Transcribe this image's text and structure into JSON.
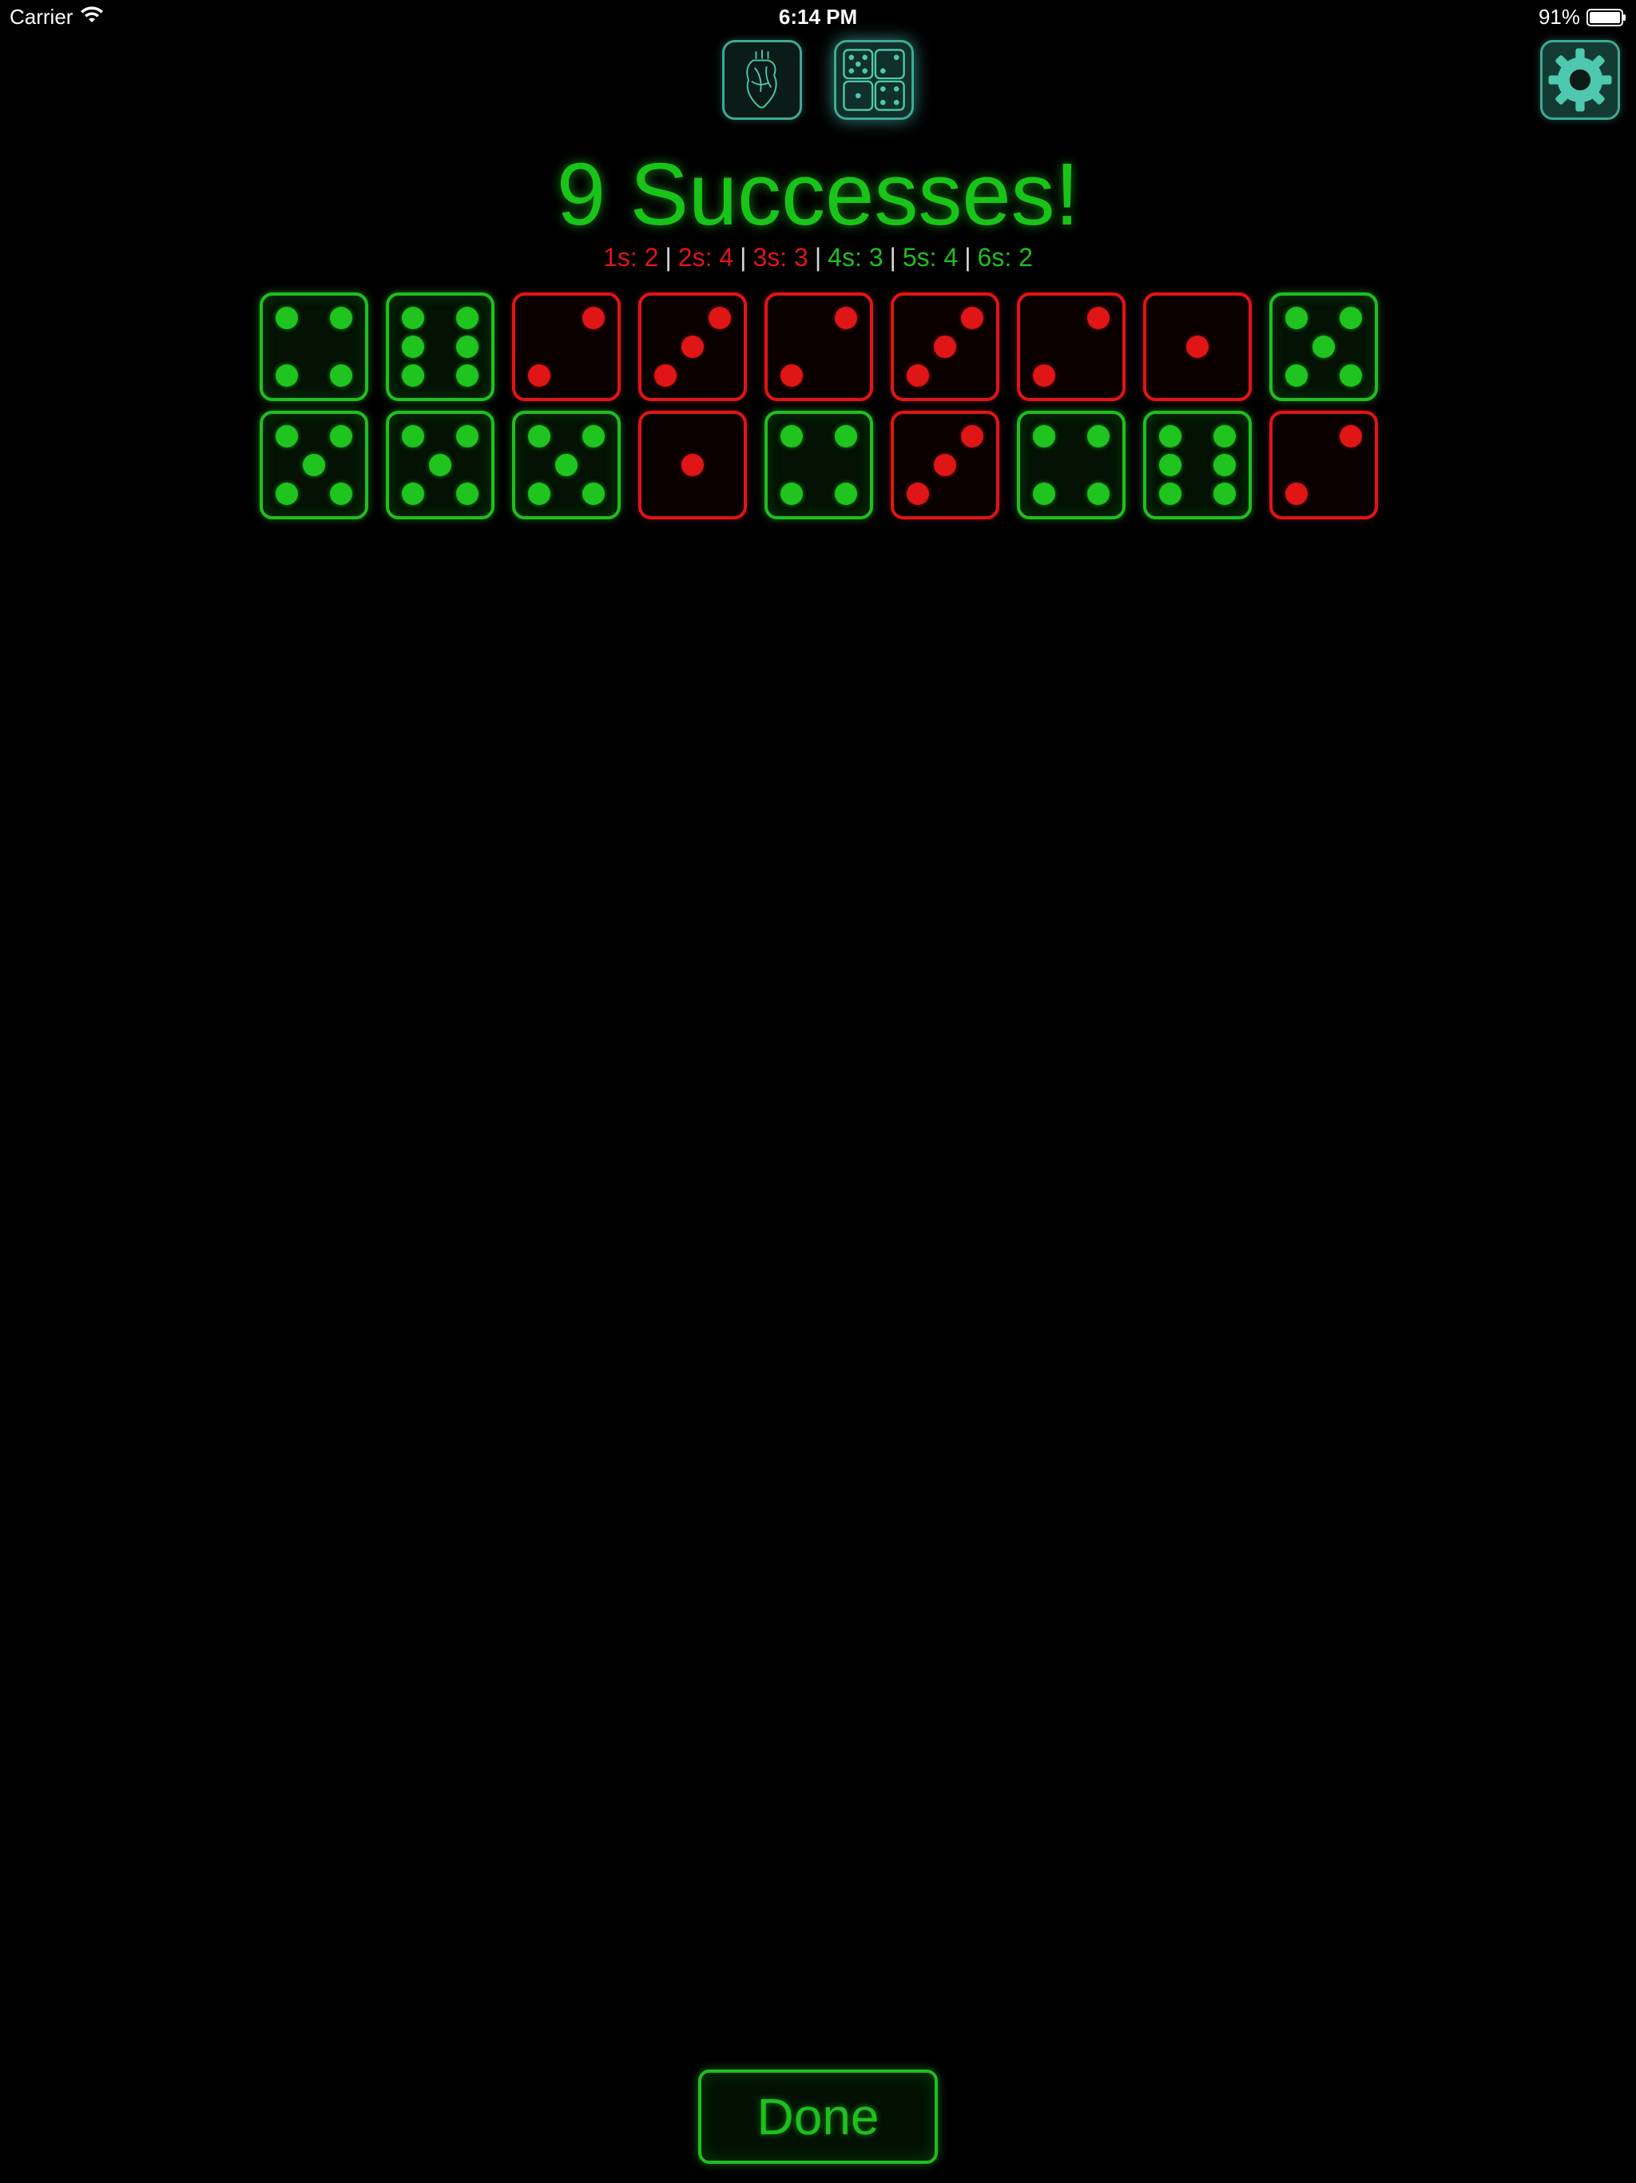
{
  "status_bar": {
    "carrier": "Carrier",
    "time": "6:14 PM",
    "battery": "91%"
  },
  "toolbar": {
    "icons": [
      "heart-anatomy-icon",
      "dice-icon",
      "gear-icon"
    ]
  },
  "result": {
    "title": "9 Successes!",
    "summary": [
      {
        "text": "1s: 2",
        "status": "fail"
      },
      {
        "text": "2s: 4",
        "status": "fail"
      },
      {
        "text": "3s: 3",
        "status": "fail"
      },
      {
        "text": "4s: 3",
        "status": "success"
      },
      {
        "text": "5s: 4",
        "status": "success"
      },
      {
        "text": "6s: 2",
        "status": "success"
      }
    ],
    "separator": "|"
  },
  "dice": [
    4,
    6,
    2,
    3,
    2,
    3,
    2,
    1,
    5,
    5,
    5,
    5,
    1,
    4,
    3,
    4,
    6,
    2
  ],
  "colors": {
    "success": "#1fbf1f",
    "fail": "#e01515",
    "accent": "#3fa894"
  },
  "actions": {
    "done_label": "Done"
  }
}
